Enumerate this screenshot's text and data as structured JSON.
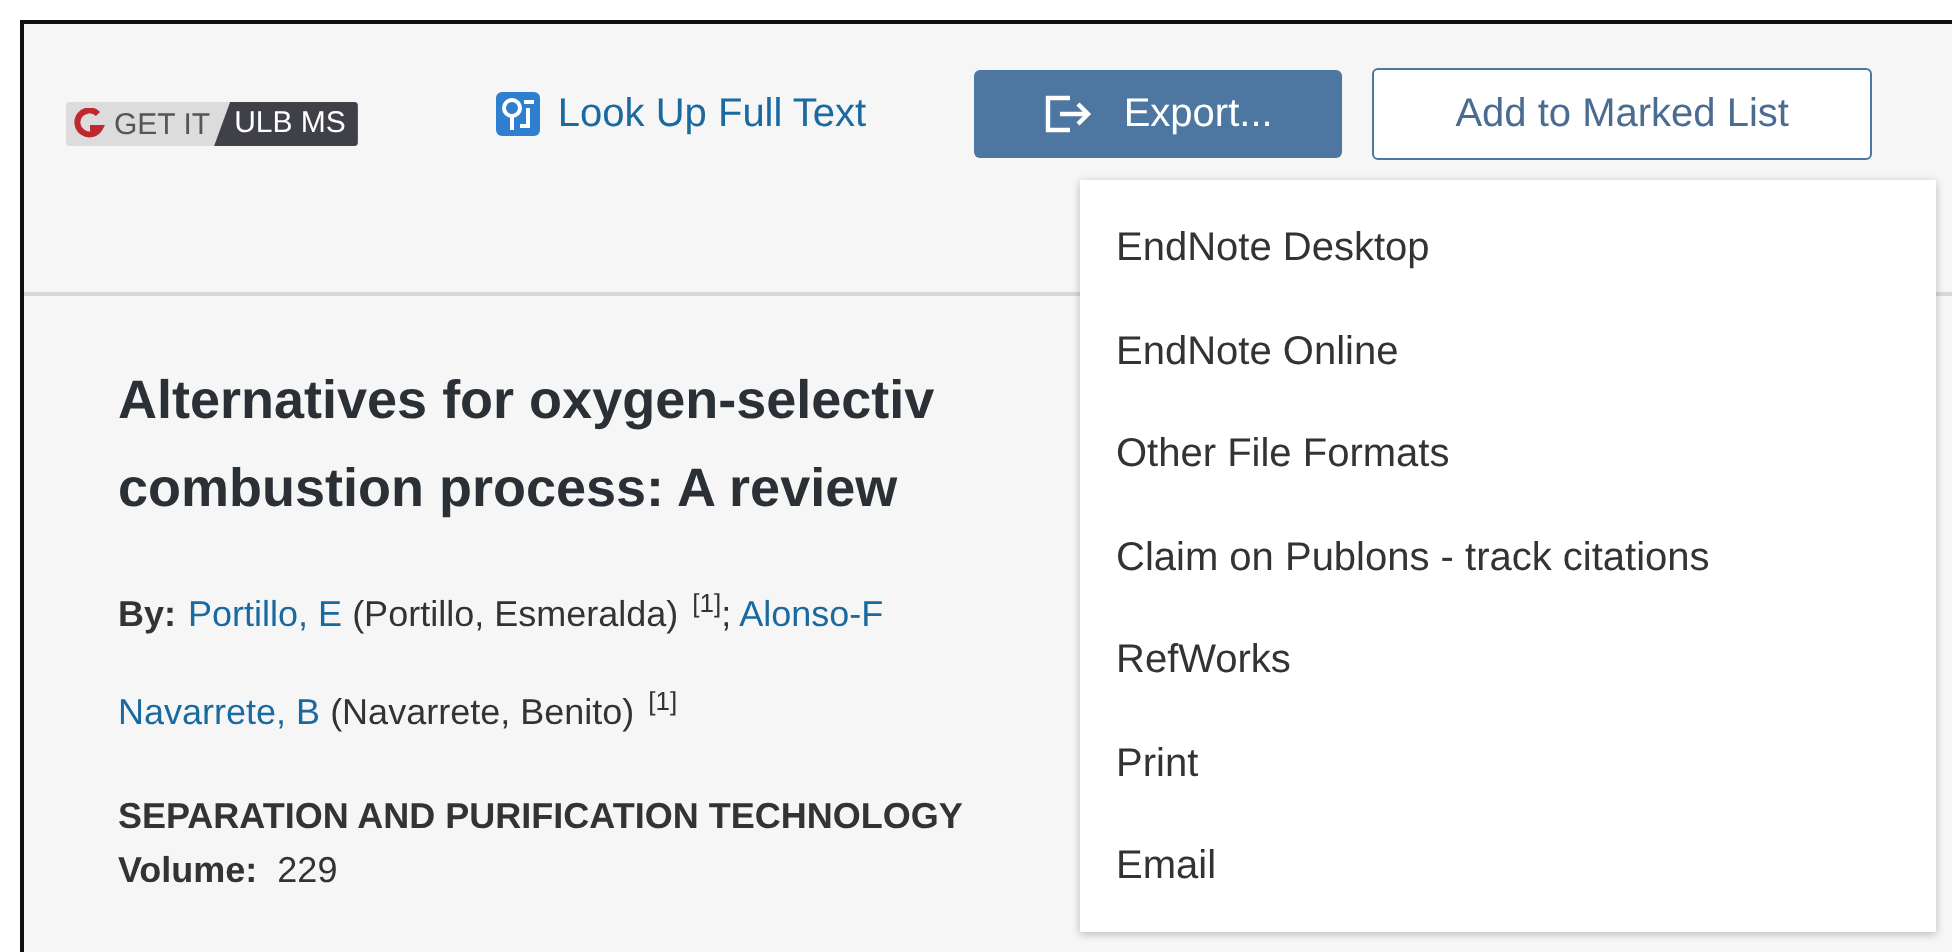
{
  "toolbar": {
    "get_it": {
      "label": "GET IT",
      "tag": "ULB MS"
    },
    "lookup": {
      "label": "Look Up Full Text"
    },
    "export": {
      "label": "Export..."
    },
    "marked_list": {
      "label": "Add to Marked List"
    }
  },
  "export_menu": [
    "EndNote Desktop",
    "EndNote Online",
    "Other File Formats",
    "Claim on Publons - track citations",
    "RefWorks",
    "Print",
    "Email"
  ],
  "record": {
    "title_lines": [
      "Alternatives for oxygen-selectiv",
      "combustion process: A review"
    ],
    "author_lines": [
      [
        {
          "kind": "label",
          "text": "By:"
        },
        {
          "kind": "link",
          "text": "Portillo, E"
        },
        {
          "kind": "text",
          "text": "(Portillo, Esmeralda)"
        },
        {
          "kind": "sup",
          "text": "[1]"
        },
        {
          "kind": "text",
          "text": ";"
        },
        {
          "kind": "link",
          "text": "Alonso-F"
        }
      ],
      [
        {
          "kind": "link",
          "text": "Navarrete, B"
        },
        {
          "kind": "text",
          "text": "(Navarrete, Benito)"
        },
        {
          "kind": "sup",
          "text": "[1]"
        }
      ]
    ],
    "journal": "SEPARATION AND PURIFICATION TECHNOLOGY",
    "volume": {
      "label": "Volume:",
      "value": "229"
    }
  }
}
